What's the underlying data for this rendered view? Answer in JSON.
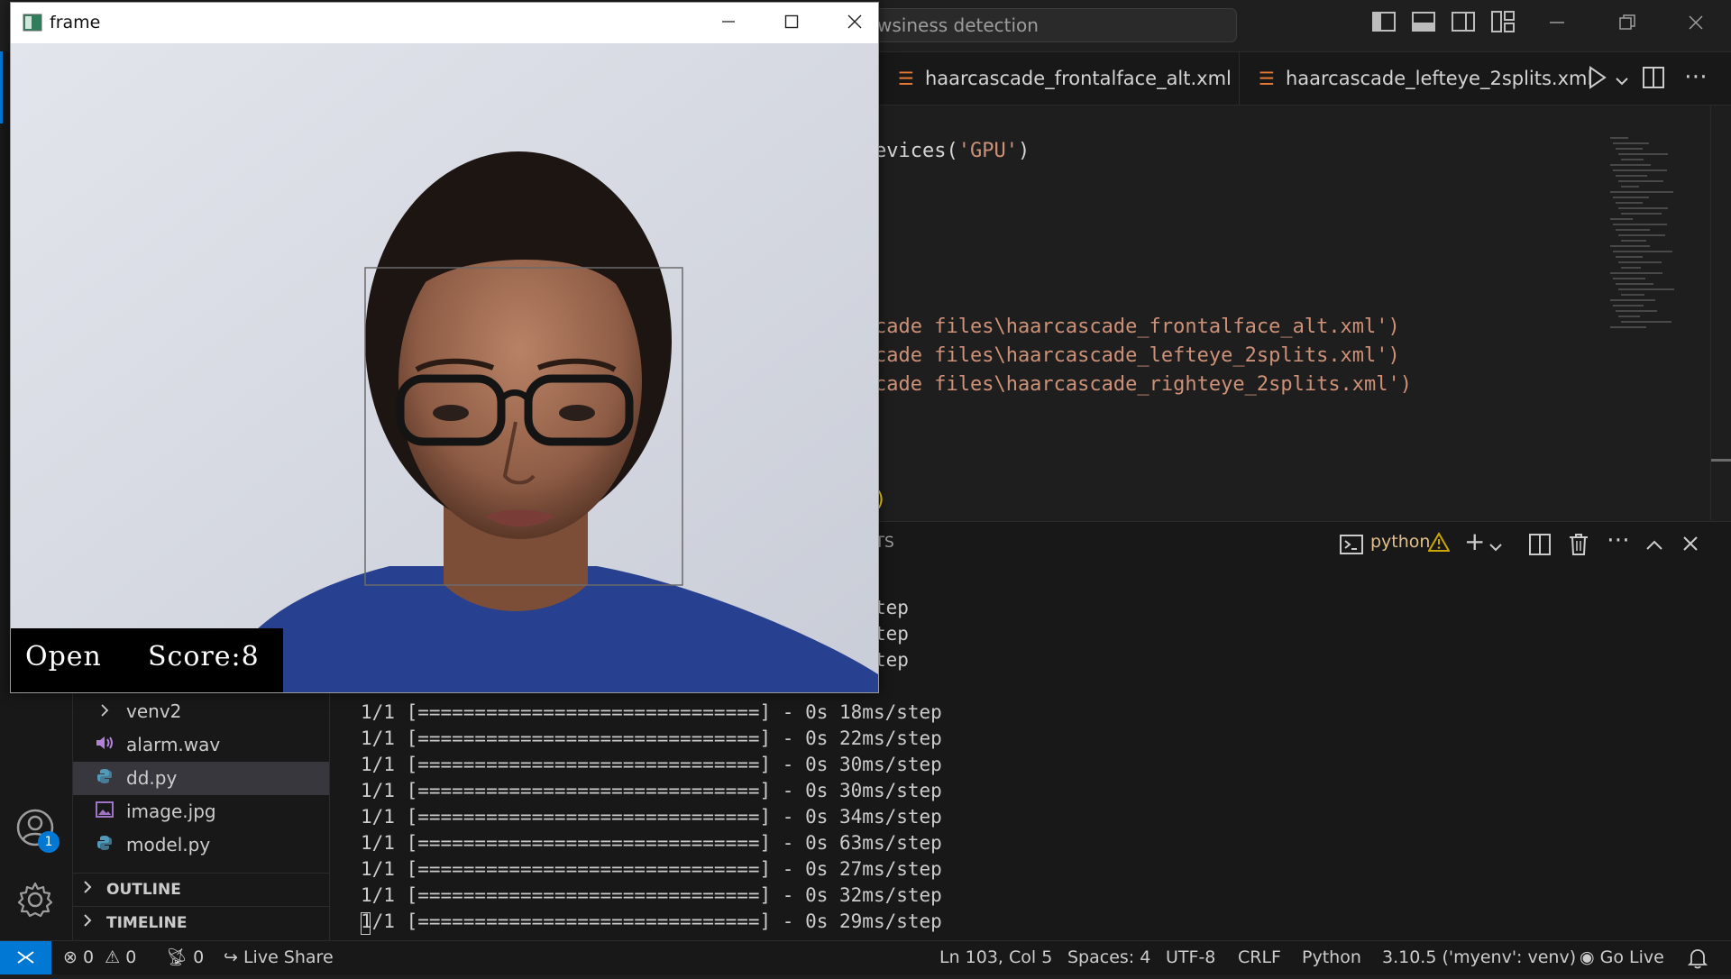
{
  "titlebar": {
    "search_text": "wsiness detection"
  },
  "tabs": [
    {
      "label": "haarcascade_frontalface_alt.xml"
    },
    {
      "label": "haarcascade_lefteye_2splits.xml"
    }
  ],
  "editor": {
    "lines": [
      {
        "pre": "evices(",
        "str": "'GPU'",
        "post": ")"
      },
      {
        "pre": "cade files\\haarcascade_frontalface_alt.xml')",
        "str": "",
        "post": ""
      },
      {
        "pre": "cade files\\haarcascade_lefteye_2splits.xml')",
        "str": "",
        "post": ""
      },
      {
        "pre": "cade files\\haarcascade_righteye_2splits.xml')",
        "str": "",
        "post": ""
      },
      {
        "pre": ")",
        "str": "",
        "post": ""
      }
    ]
  },
  "panel": {
    "tab_fragment": "RTS",
    "terminal_name": "python",
    "lines": [
      "tep",
      "tep",
      "tep",
      "1/1 [==============================] - 0s 18ms/step",
      "1/1 [==============================] - 0s 22ms/step",
      "1/1 [==============================] - 0s 30ms/step",
      "1/1 [==============================] - 0s 30ms/step",
      "1/1 [==============================] - 0s 34ms/step",
      "1/1 [==============================] - 0s 63ms/step",
      "1/1 [==============================] - 0s 27ms/step",
      "1/1 [==============================] - 0s 32ms/step",
      "1/1 [==============================] - 0s 29ms/step"
    ]
  },
  "explorer": {
    "items": [
      {
        "label": "venv2",
        "icon": "chevron-right-icon"
      },
      {
        "label": "alarm.wav",
        "icon": "audio-file-icon"
      },
      {
        "label": "dd.py",
        "icon": "python-file-icon",
        "selected": true
      },
      {
        "label": "image.jpg",
        "icon": "image-file-icon"
      },
      {
        "label": "model.py",
        "icon": "python-file-icon"
      }
    ],
    "sections": [
      {
        "label": "OUTLINE"
      },
      {
        "label": "TIMELINE"
      }
    ]
  },
  "activity": {
    "accounts_badge": "1"
  },
  "statusbar": {
    "errors": "0",
    "warnings": "0",
    "ports": "0",
    "live_share": "Live Share",
    "position": "Ln 103, Col 5",
    "spaces": "Spaces: 4",
    "encoding": "UTF-8",
    "eol": "CRLF",
    "language": "Python",
    "interpreter": "3.10.5 ('myenv': venv)",
    "go_live": "Go Live"
  },
  "frame_window": {
    "title": "frame",
    "status": "Open",
    "score": "Score:8"
  },
  "colors": {
    "accent": "#0078d4",
    "string": "#ce9178",
    "bracket": "#ffd700",
    "warning": "#cca700",
    "rss": "#e37933"
  }
}
